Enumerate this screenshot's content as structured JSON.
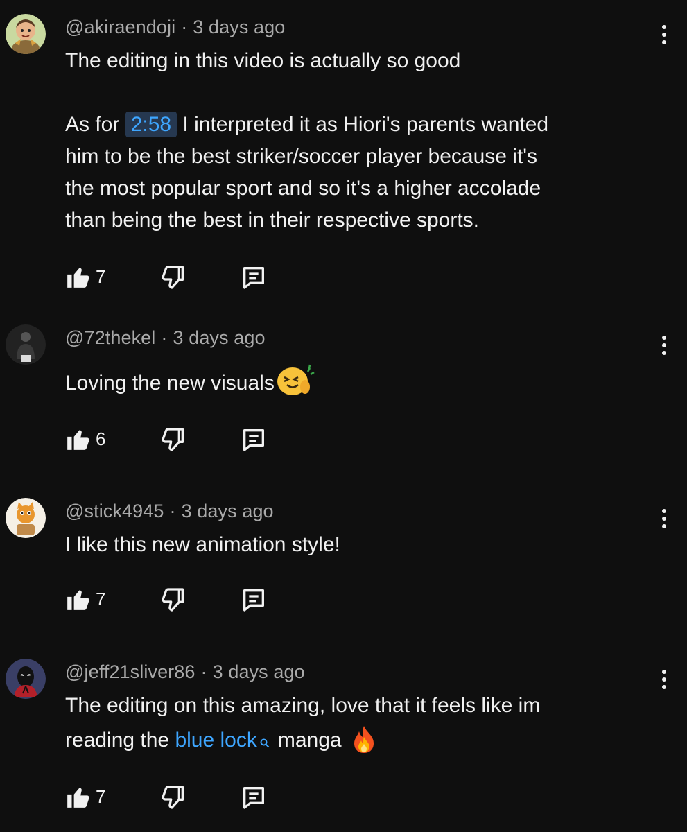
{
  "comments": [
    {
      "author": "@akiraendoji",
      "age": "3 days ago",
      "line1": "The editing in this video is actually so good",
      "p2_prefix": "As for ",
      "timestamp": "2:58",
      "p2_first": " I interpreted it as Hiori's parents wanted",
      "p2_rest_1": "him to be the best striker/soccer player because it's",
      "p2_rest_2": "the most popular sport and so it's a higher accolade",
      "p2_rest_3": "than being the best in their respective sports.",
      "likes": "7",
      "avatar_icon": "cartoon-avatar",
      "avatar_color": "#c9d9a0"
    },
    {
      "author": "@72thekel",
      "age": "3 days ago",
      "text": "Loving the new visuals",
      "emoji": "hugging-face-emoji",
      "likes": "6",
      "avatar_icon": "dark-photo-avatar",
      "avatar_color": "#222222"
    },
    {
      "author": "@stick4945",
      "age": "3 days ago",
      "text": "I like this new animation style!",
      "likes": "7",
      "avatar_icon": "cartoon-cat-avatar",
      "avatar_color": "#f5f0e6"
    },
    {
      "author": "@jeff21sliver86",
      "age": "3 days ago",
      "line1": "The editing on this amazing, love that it feels like im",
      "line2_prefix": "reading the ",
      "link": "blue lock",
      "line2_suffix": "manga",
      "emoji": "fire-emoji",
      "likes": "7",
      "avatar_icon": "spider-hero-avatar",
      "avatar_color": "#3a3f66"
    }
  ],
  "colors": {
    "background": "#0f0f0f",
    "text": "#f1f1f1",
    "secondary_text": "#aaaaaa",
    "link": "#3ea6ff",
    "timestamp_bg": "#263850"
  }
}
